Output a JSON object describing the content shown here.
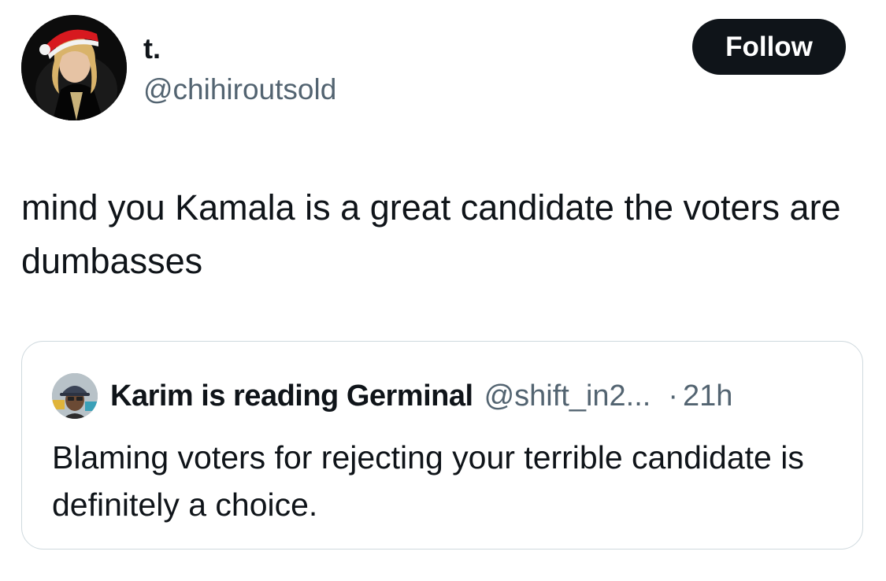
{
  "author": {
    "display_name": "t.",
    "handle": "@chihiroutsold",
    "avatar_icon": "profile-photo-santa-hat"
  },
  "follow_button": {
    "label": "Follow",
    "background": "#0f1419",
    "text_color": "#ffffff"
  },
  "tweet": {
    "text": "mind you Kamala is a great candidate the voters are dumbasses"
  },
  "quoted_tweet": {
    "display_name": "Karim is reading Germinal",
    "handle": "@shift_in2...",
    "separator": "·",
    "time": "21h",
    "text": "Blaming voters for rejecting your terrible candidate is definitely a choice.",
    "avatar_icon": "profile-photo-cap"
  },
  "colors": {
    "primary_text": "#0f1419",
    "secondary_text": "#536471",
    "card_border": "#cfd9de"
  }
}
